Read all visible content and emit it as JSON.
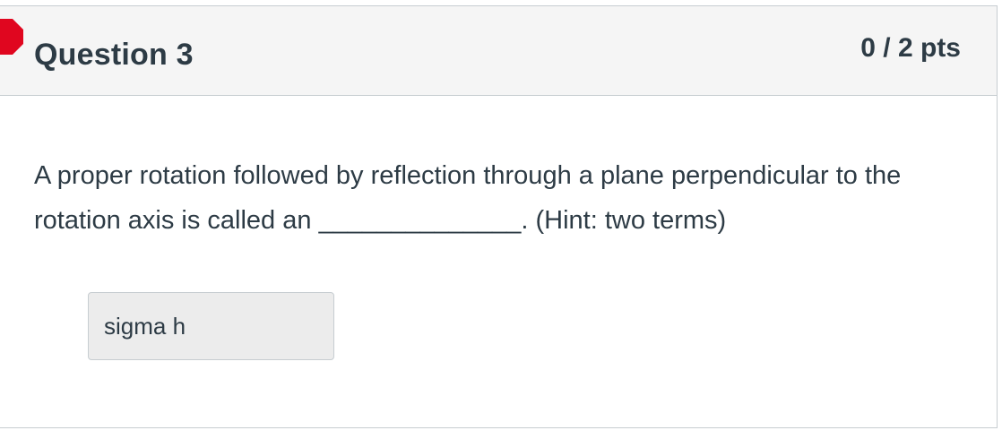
{
  "question": {
    "title": "Question 3",
    "points": "0 / 2 pts",
    "status_color": "#e0061f",
    "text_part1": "A proper rotation followed by reflection through a plane perpendicular to the rotation axis is called an ",
    "blank": "______________",
    "text_part2": ". (Hint: two terms)",
    "answer": "sigma h",
    "icon": "incorrect-marker-icon"
  }
}
